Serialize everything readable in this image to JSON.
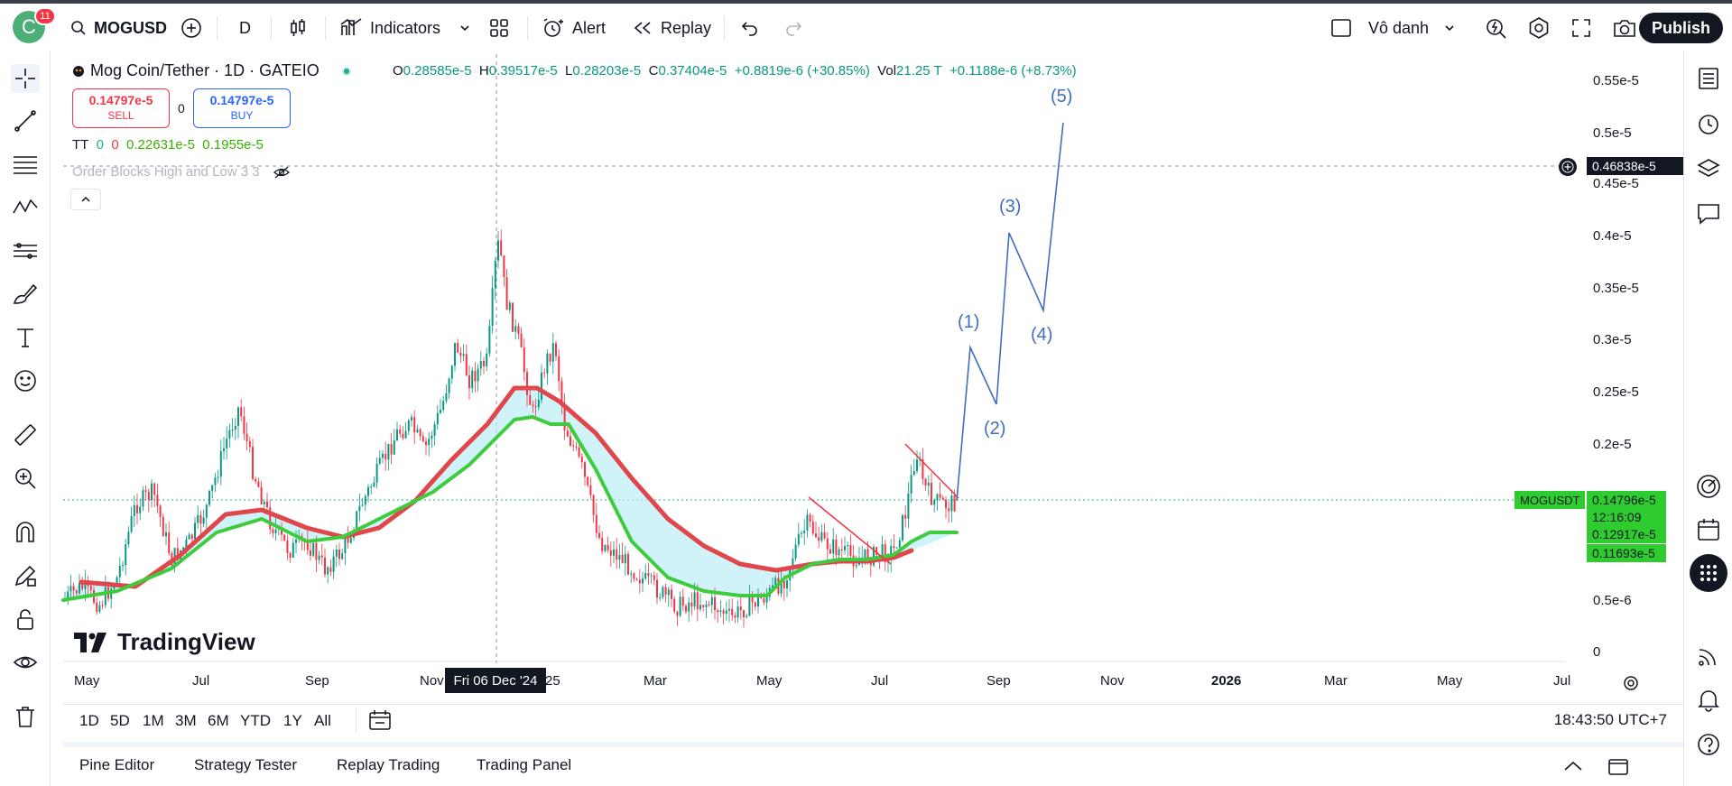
{
  "topbar": {
    "avatar_letter": "C",
    "notification_count": "11",
    "symbol": "MOGUSD",
    "interval": "D",
    "indicators_label": "Indicators",
    "alert_label": "Alert",
    "replay_label": "Replay",
    "layout_name": "Vô danh",
    "publish_label": "Publish"
  },
  "legend": {
    "title": "Mog Coin/Tether · 1D · GATEIO",
    "open_label": "O",
    "open": "0.28585e-5",
    "high_label": "H",
    "high": "0.39517e-5",
    "low_label": "L",
    "low": "0.28203e-5",
    "close_label": "C",
    "close": "0.37404e-5",
    "change": "+0.8819e-6 (+30.85%)",
    "vol_label": "Vol",
    "vol": "21.25 T",
    "vol_change": "+0.1188e-6 (+8.73%)",
    "sell_price": "0.14797e-5",
    "sell_label": "SELL",
    "spread": "0",
    "buy_price": "0.14797e-5",
    "buy_label": "BUY",
    "tt_label": "TT",
    "tt_v1": "0",
    "tt_v2": "0",
    "tt_v3": "0.22631e-5",
    "tt_v4": "0.1955e-5",
    "ob_label": "Order Blocks High and Low 3 3"
  },
  "price_axis": [
    "0.55e-5",
    "0.5e-5",
    "0.45e-5",
    "0.4e-5",
    "0.35e-5",
    "0.3e-5",
    "0.25e-5",
    "0.2e-5",
    "0.5e-6",
    "0"
  ],
  "price_tags": {
    "crosshair": "0.46838e-5",
    "symbol_tag": "MOGUSDT",
    "last": "0.14796e-5",
    "countdown": "12:16:09",
    "ma1": "0.12917e-5",
    "ma2": "0.11693e-5"
  },
  "time_axis": [
    "May",
    "Jul",
    "Sep",
    "Nov",
    "25",
    "Mar",
    "May",
    "Jul",
    "Sep",
    "Nov",
    "2026",
    "Mar",
    "May",
    "Jul"
  ],
  "crosshair_date": "Fri 06 Dec '24",
  "wave_labels": [
    "(1)",
    "(2)",
    "(3)",
    "(4)",
    "(5)"
  ],
  "logo_text": "TradingView",
  "ranges": [
    "1D",
    "5D",
    "1M",
    "3M",
    "6M",
    "YTD",
    "1Y",
    "All"
  ],
  "clock": "18:43:50 UTC+7",
  "bottom_tabs": [
    "Pine Editor",
    "Strategy Tester",
    "Replay Trading",
    "Trading Panel"
  ],
  "colors": {
    "up": "#089981",
    "down": "#f23645",
    "ma_red": "#e0474c",
    "ma_green": "#3ecb3e",
    "cloud": "#b5ecf5",
    "wave": "#3f6fbf",
    "tag_green": "#2ecc2e"
  }
}
